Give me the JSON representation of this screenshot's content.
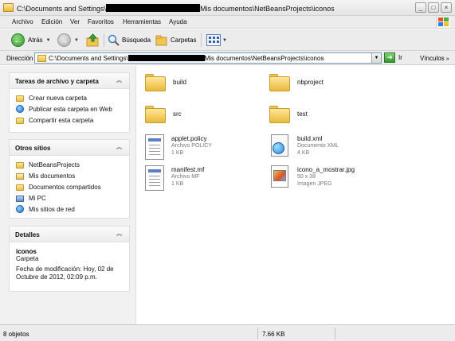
{
  "window": {
    "title_prefix": "C:\\Documents and Settings\\",
    "title_suffix": "Mis documentos\\NetBeansProjects\\iconos"
  },
  "menu": [
    "Archivo",
    "Edición",
    "Ver",
    "Favoritos",
    "Herramientas",
    "Ayuda"
  ],
  "toolbar": {
    "back": "Atrás",
    "search": "Búsqueda",
    "folders": "Carpetas"
  },
  "address": {
    "label": "Dirección",
    "path_prefix": "C:\\Documents and Settings\\",
    "path_suffix": "Mis documentos\\NetBeansProjects\\iconos",
    "go": "Ir",
    "links": "Vínculos"
  },
  "tasks_panel": {
    "title": "Tareas de archivo y carpeta",
    "items": [
      "Crear nueva carpeta",
      "Publicar esta carpeta en Web",
      "Compartir esta carpeta"
    ]
  },
  "places_panel": {
    "title": "Otros sitios",
    "items": [
      "NetBeansProjects",
      "Mis documentos",
      "Documentos compartidos",
      "Mi PC",
      "Mis sitios de red"
    ]
  },
  "details_panel": {
    "title": "Detalles",
    "name": "iconos",
    "type": "Carpeta",
    "modified_1": "Fecha de modificación: Hoy, 02 de",
    "modified_2": "Octubre de 2012, 02:09 p.m."
  },
  "files": [
    {
      "name": "build",
      "kind": "folder"
    },
    {
      "name": "nbproject",
      "kind": "folder"
    },
    {
      "name": "src",
      "kind": "folder"
    },
    {
      "name": "test",
      "kind": "folder"
    },
    {
      "name": "applet.policy",
      "type": "Archivo POLICY",
      "size": "1 KB",
      "kind": "doc"
    },
    {
      "name": "build.xml",
      "type": "Documento XML",
      "size": "4 KB",
      "kind": "xml"
    },
    {
      "name": "manifest.mf",
      "type": "Archivo MF",
      "size": "1 KB",
      "kind": "doc"
    },
    {
      "name": "icono_a_mostrar.jpg",
      "dims": "50 x 38",
      "type": "Imagen JPEG",
      "kind": "jpg"
    }
  ],
  "status": {
    "count": "8 objetos",
    "size": "7.66 KB"
  }
}
